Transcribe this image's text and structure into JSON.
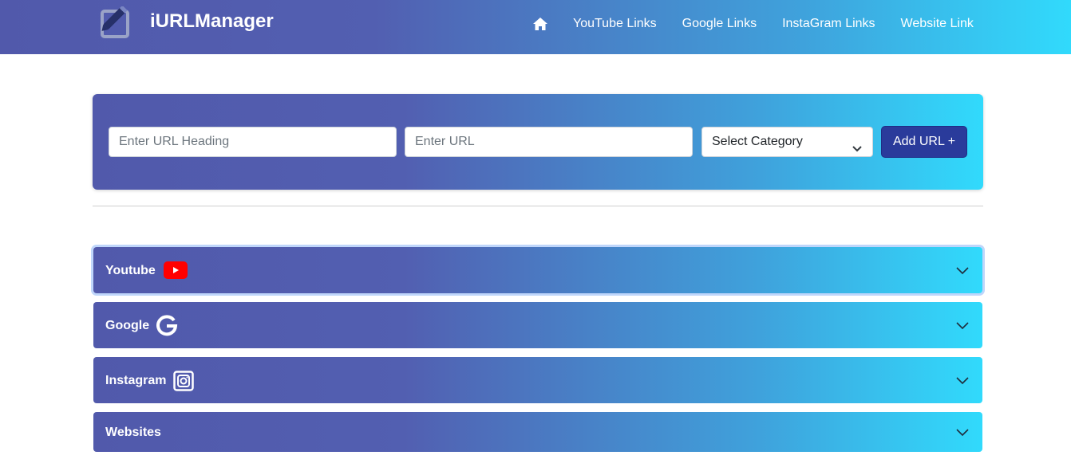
{
  "navbar": {
    "brand": "iURLManager",
    "brand_icon": "edit-note-icon",
    "home_icon": "home-icon",
    "links": [
      "YouTube Links",
      "Google Links",
      "InstaGram Links",
      "Website Link"
    ]
  },
  "form": {
    "heading_placeholder": "Enter URL Heading",
    "url_placeholder": "Enter URL",
    "category_selected": "Select Category",
    "add_button": "Add URL +"
  },
  "accordion": [
    {
      "label": "Youtube",
      "icon": "youtube-icon"
    },
    {
      "label": "Google",
      "icon": "google-icon"
    },
    {
      "label": "Instagram",
      "icon": "instagram-icon"
    },
    {
      "label": "Websites",
      "icon": ""
    }
  ],
  "colors": {
    "gradient_start": "#5159ab",
    "gradient_end": "#31dafc",
    "button": "#2a3b9b",
    "youtube_red": "#ff0000"
  }
}
